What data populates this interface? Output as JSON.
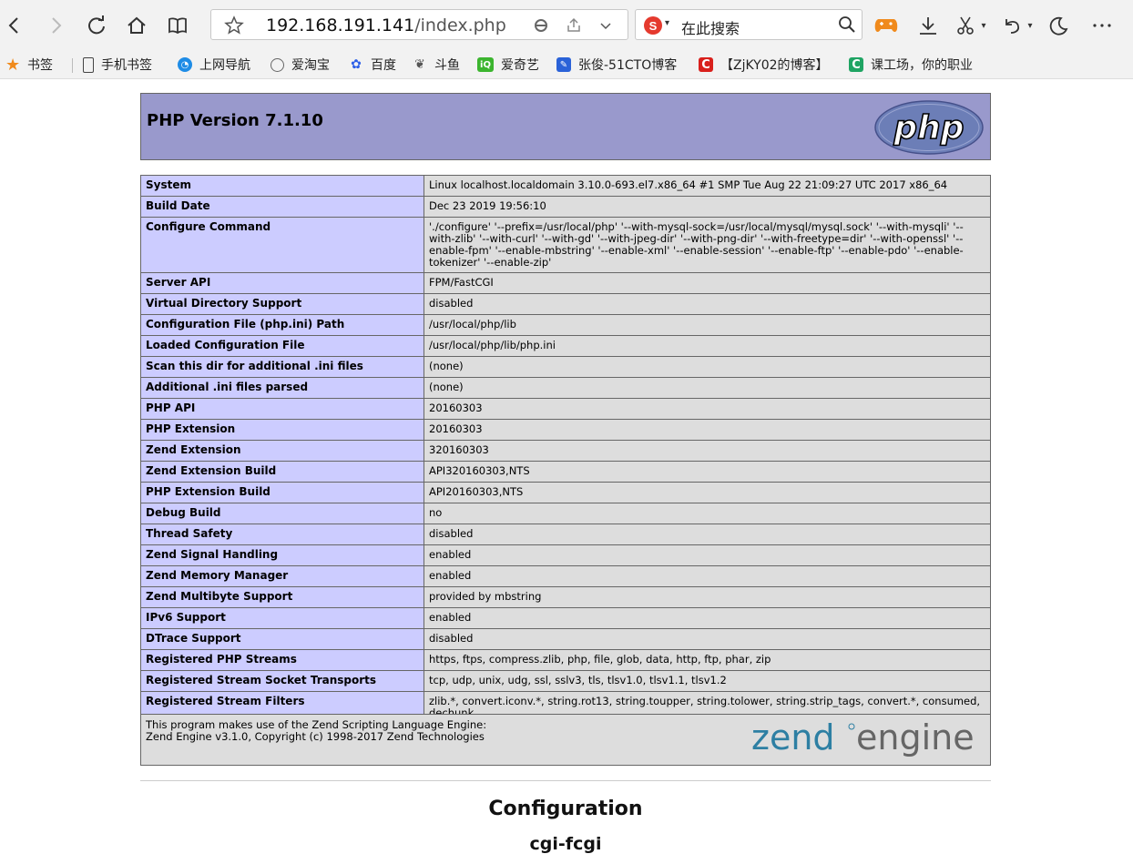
{
  "browser": {
    "url_host": "192.168.191.141",
    "url_path": "/index.php",
    "search_placeholder": "在此搜索",
    "search_engine_letter": "S",
    "bookmarks": [
      {
        "label": "书签",
        "icon": "star-icon"
      },
      {
        "label": "手机书签",
        "icon": "phone-icon"
      },
      {
        "label": "上网导航",
        "icon": "navigation-icon"
      },
      {
        "label": "爱淘宝",
        "icon": "globe-icon"
      },
      {
        "label": "百度",
        "icon": "baidu-paw-icon"
      },
      {
        "label": "斗鱼",
        "icon": "douyu-icon"
      },
      {
        "label": "爱奇艺",
        "icon": "iqiyi-icon"
      },
      {
        "label": "张俊-51CTO博客",
        "icon": "pen-icon"
      },
      {
        "label": "【ZjKY02的博客】",
        "icon": "csdn-icon"
      },
      {
        "label": "课工场，你的职业",
        "icon": "kgc-icon"
      }
    ],
    "icon_letters": {
      "csdn": "C",
      "kgc": "C"
    },
    "colors": {
      "chrome_bg": "#f2f2f2",
      "accent_orange": "#f08a1c"
    }
  },
  "phpinfo": {
    "title": "PHP Version 7.1.10",
    "info_rows": [
      {
        "key": "System",
        "value": "Linux localhost.localdomain 3.10.0-693.el7.x86_64 #1 SMP Tue Aug 22 21:09:27 UTC 2017 x86_64"
      },
      {
        "key": "Build Date",
        "value": "Dec 23 2019 19:56:10"
      },
      {
        "key": "Configure Command",
        "value": "'./configure' '--prefix=/usr/local/php' '--with-mysql-sock=/usr/local/mysql/mysql.sock' '--with-mysqli' '--with-zlib' '--with-curl' '--with-gd' '--with-jpeg-dir' '--with-png-dir' '--with-freetype=dir' '--with-openssl' '--enable-fpm' '--enable-mbstring' '--enable-xml' '--enable-session' '--enable-ftp' '--enable-pdo' '--enable-tokenizer' '--enable-zip'"
      },
      {
        "key": "Server API",
        "value": "FPM/FastCGI"
      },
      {
        "key": "Virtual Directory Support",
        "value": "disabled"
      },
      {
        "key": "Configuration File (php.ini) Path",
        "value": "/usr/local/php/lib"
      },
      {
        "key": "Loaded Configuration File",
        "value": "/usr/local/php/lib/php.ini"
      },
      {
        "key": "Scan this dir for additional .ini files",
        "value": "(none)"
      },
      {
        "key": "Additional .ini files parsed",
        "value": "(none)"
      },
      {
        "key": "PHP API",
        "value": "20160303"
      },
      {
        "key": "PHP Extension",
        "value": "20160303"
      },
      {
        "key": "Zend Extension",
        "value": "320160303"
      },
      {
        "key": "Zend Extension Build",
        "value": "API320160303,NTS"
      },
      {
        "key": "PHP Extension Build",
        "value": "API20160303,NTS"
      },
      {
        "key": "Debug Build",
        "value": "no"
      },
      {
        "key": "Thread Safety",
        "value": "disabled"
      },
      {
        "key": "Zend Signal Handling",
        "value": "enabled"
      },
      {
        "key": "Zend Memory Manager",
        "value": "enabled"
      },
      {
        "key": "Zend Multibyte Support",
        "value": "provided by mbstring"
      },
      {
        "key": "IPv6 Support",
        "value": "enabled"
      },
      {
        "key": "DTrace Support",
        "value": "disabled"
      },
      {
        "key": "Registered PHP Streams",
        "value": "https, ftps, compress.zlib, php, file, glob, data, http, ftp, phar, zip"
      },
      {
        "key": "Registered Stream Socket Transports",
        "value": "tcp, udp, unix, udg, ssl, sslv3, tls, tlsv1.0, tlsv1.1, tlsv1.2"
      },
      {
        "key": "Registered Stream Filters",
        "value": "zlib.*, convert.iconv.*, string.rot13, string.toupper, string.tolower, string.strip_tags, convert.*, consumed, dechunk"
      }
    ],
    "zend_line1": "This program makes use of the Zend Scripting Language Engine:",
    "zend_line2": "Zend Engine v3.1.0, Copyright (c) 1998-2017 Zend Technologies",
    "php_logo_text": "php",
    "zend_logo_text_a": "zend",
    "zend_logo_text_b": "engine",
    "section_title": "Configuration",
    "subsection_title": "cgi-fcgi",
    "colors": {
      "header_bg": "#9999cc",
      "key_bg": "#ccccff",
      "value_bg": "#dddddd",
      "zend_blue": "#2d7fa3"
    }
  }
}
